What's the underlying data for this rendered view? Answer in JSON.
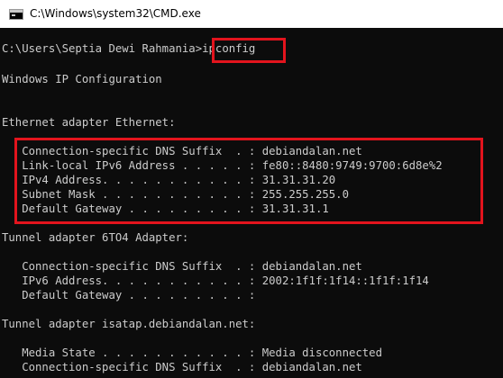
{
  "window": {
    "title": "C:\\Windows\\system32\\CMD.exe",
    "icon": "cmd-console-icon"
  },
  "console": {
    "prompt": "C:\\Users\\Septia Dewi Rahmania>",
    "command": "ipconfig",
    "heading": "Windows IP Configuration",
    "ethernet": {
      "header": "Ethernet adapter Ethernet:",
      "dns_suffix": "   Connection-specific DNS Suffix  . : debiandalan.net",
      "link_local_ipv6": "   Link-local IPv6 Address . . . . . : fe80::8480:9749:9700:6d8e%2",
      "ipv4": "   IPv4 Address. . . . . . . . . . . : 31.31.31.20",
      "subnet_mask": "   Subnet Mask . . . . . . . . . . . : 255.255.255.0",
      "default_gateway": "   Default Gateway . . . . . . . . . : 31.31.31.1"
    },
    "tunnel_6to4": {
      "header": "Tunnel adapter 6TO4 Adapter:",
      "dns_suffix": "   Connection-specific DNS Suffix  . : debiandalan.net",
      "ipv6": "   IPv6 Address. . . . . . . . . . . : 2002:1f1f:1f14::1f1f:1f14",
      "default_gateway": "   Default Gateway . . . . . . . . . :"
    },
    "tunnel_isatap": {
      "header": "Tunnel adapter isatap.debiandalan.net:",
      "media_state": "   Media State . . . . . . . . . . . : Media disconnected",
      "dns_suffix": "   Connection-specific DNS Suffix  . : debiandalan.net"
    }
  },
  "colors": {
    "console_background": "#0c0c0c",
    "console_text": "#cccccc",
    "highlight": "#e3141d",
    "titlebar": "#ffffff"
  }
}
